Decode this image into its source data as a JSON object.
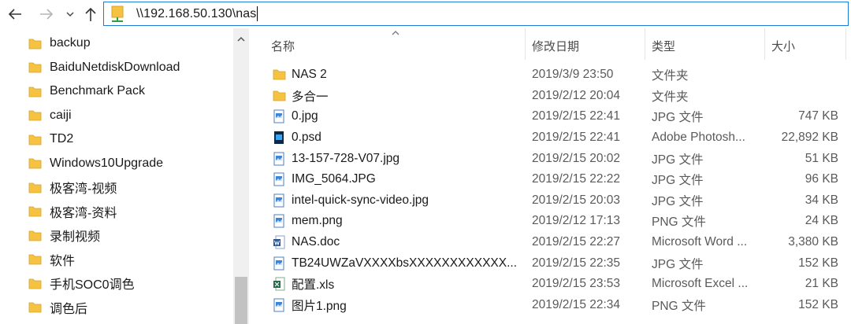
{
  "address": {
    "path": "\\\\192.168.50.130\\nas"
  },
  "nav": {
    "items": [
      {
        "label": "backup"
      },
      {
        "label": "BaiduNetdiskDownload"
      },
      {
        "label": "Benchmark Pack"
      },
      {
        "label": "caiji"
      },
      {
        "label": "TD2"
      },
      {
        "label": "Windows10Upgrade"
      },
      {
        "label": "极客湾-视频"
      },
      {
        "label": "极客湾-资料"
      },
      {
        "label": "录制视频"
      },
      {
        "label": "软件"
      },
      {
        "label": "手机SOC0调色"
      },
      {
        "label": "调色后"
      }
    ]
  },
  "columns": {
    "name": "名称",
    "date": "修改日期",
    "type": "类型",
    "size": "大小"
  },
  "files": [
    {
      "name": "NAS 2",
      "date": "2019/3/9 23:50",
      "type": "文件夹",
      "size": "",
      "icon": "folder-icon"
    },
    {
      "name": "多合一",
      "date": "2019/2/12 20:04",
      "type": "文件夹",
      "size": "",
      "icon": "folder-icon"
    },
    {
      "name": "0.jpg",
      "date": "2019/2/15 22:41",
      "type": "JPG 文件",
      "size": "747 KB",
      "icon": "image-file-icon"
    },
    {
      "name": "0.psd",
      "date": "2019/2/15 22:41",
      "type": "Adobe Photosh...",
      "size": "22,892 KB",
      "icon": "photoshop-file-icon"
    },
    {
      "name": "13-157-728-V07.jpg",
      "date": "2019/2/15 20:02",
      "type": "JPG 文件",
      "size": "51 KB",
      "icon": "image-file-icon"
    },
    {
      "name": "IMG_5064.JPG",
      "date": "2019/2/15 22:22",
      "type": "JPG 文件",
      "size": "96 KB",
      "icon": "image-file-icon"
    },
    {
      "name": "intel-quick-sync-video.jpg",
      "date": "2019/2/15 20:03",
      "type": "JPG 文件",
      "size": "34 KB",
      "icon": "image-file-icon"
    },
    {
      "name": "mem.png",
      "date": "2019/2/12 17:13",
      "type": "PNG 文件",
      "size": "24 KB",
      "icon": "image-file-icon"
    },
    {
      "name": "NAS.doc",
      "date": "2019/2/15 22:27",
      "type": "Microsoft Word ...",
      "size": "3,380 KB",
      "icon": "word-file-icon"
    },
    {
      "name": "TB24UWZaVXXXXbsXXXXXXXXXXXX...",
      "date": "2019/2/15 22:35",
      "type": "JPG 文件",
      "size": "152 KB",
      "icon": "image-file-icon"
    },
    {
      "name": "配置.xls",
      "date": "2019/2/15 23:53",
      "type": "Microsoft Excel ...",
      "size": "21 KB",
      "icon": "excel-file-icon"
    },
    {
      "name": "图片1.png",
      "date": "2019/2/15 22:34",
      "type": "PNG 文件",
      "size": "152 KB",
      "icon": "image-file-icon"
    }
  ],
  "colors": {
    "folder": "#f5c242",
    "accent": "#1e7bd7",
    "word": "#2b5797",
    "excel": "#1e7145",
    "photoshop": "#0b2a4a"
  }
}
